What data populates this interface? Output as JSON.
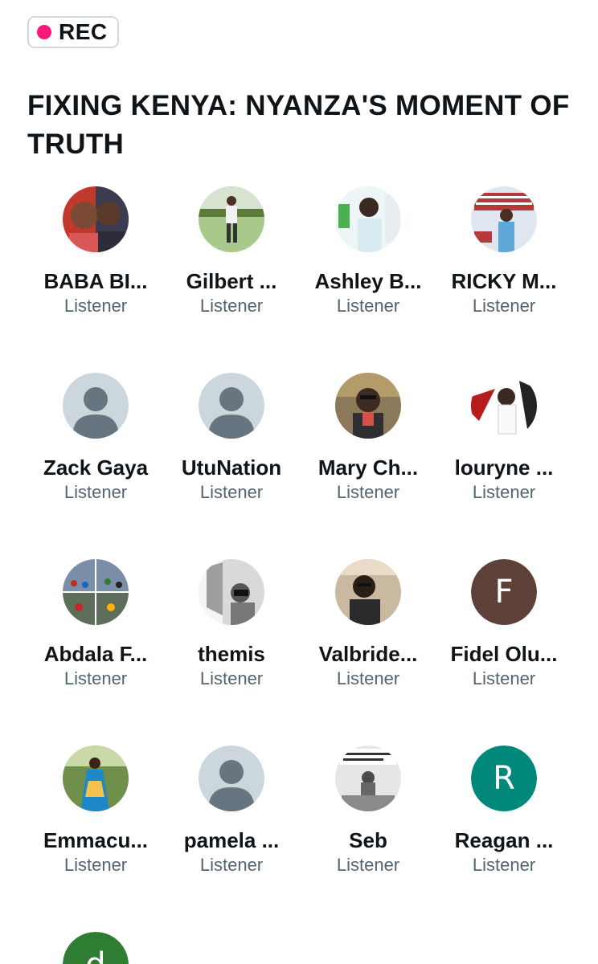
{
  "rec_label": "REC",
  "title": "FIXING KENYA: NYANZA'S MOMENT OF TRUTH",
  "colors": {
    "rec_dot": "#f91880",
    "default_avatar_bg": "#ccd6dd",
    "default_avatar_fg": "#66757f",
    "role_text": "#536471"
  },
  "participants": [
    {
      "name": "BABA BI...",
      "role": "Listener",
      "avatar": "photo"
    },
    {
      "name": "Gilbert ...",
      "role": "Listener",
      "avatar": "photo"
    },
    {
      "name": "Ashley B...",
      "role": "Listener",
      "avatar": "photo"
    },
    {
      "name": "RICKY M...",
      "role": "Listener",
      "avatar": "photo"
    },
    {
      "name": "Zack Gaya",
      "role": "Listener",
      "avatar": "default"
    },
    {
      "name": "UtuNation",
      "role": "Listener",
      "avatar": "default"
    },
    {
      "name": "Mary Ch...",
      "role": "Listener",
      "avatar": "photo"
    },
    {
      "name": "louryne ...",
      "role": "Listener",
      "avatar": "photo"
    },
    {
      "name": "Abdala F...",
      "role": "Listener",
      "avatar": "photo"
    },
    {
      "name": "themis",
      "role": "Listener",
      "avatar": "photo"
    },
    {
      "name": "Valbride...",
      "role": "Listener",
      "avatar": "photo"
    },
    {
      "name": "Fidel Olu...",
      "role": "Listener",
      "avatar": "letter",
      "letter": "F",
      "color": "#5d4037"
    },
    {
      "name": "Emmacu...",
      "role": "Listener",
      "avatar": "photo"
    },
    {
      "name": "pamela ...",
      "role": "Listener",
      "avatar": "default"
    },
    {
      "name": "Seb",
      "role": "Listener",
      "avatar": "photo"
    },
    {
      "name": "Reagan ...",
      "role": "Listener",
      "avatar": "letter",
      "letter": "R",
      "color": "#00897b"
    },
    {
      "name": "",
      "role": "",
      "avatar": "letter",
      "letter": "d",
      "color": "#2e7d32"
    }
  ]
}
